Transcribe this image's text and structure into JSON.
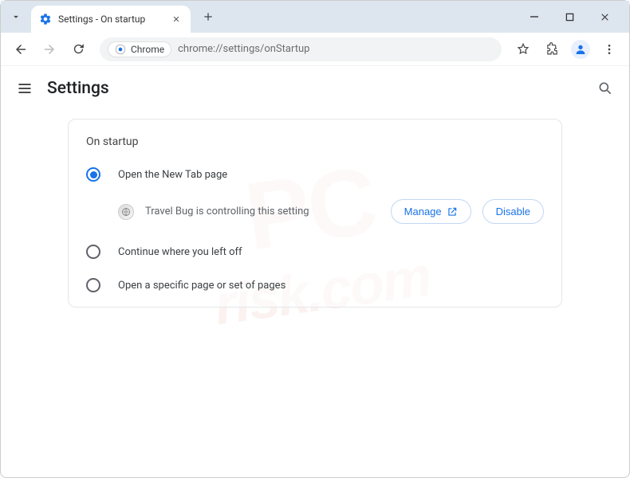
{
  "window": {
    "tab_title": "Settings - On startup",
    "url_chip": "Chrome",
    "url": "chrome://settings/onStartup"
  },
  "settings": {
    "title": "Settings",
    "section_title": "On startup",
    "options": [
      {
        "label": "Open the New Tab page",
        "selected": true
      },
      {
        "label": "Continue where you left off",
        "selected": false
      },
      {
        "label": "Open a specific page or set of pages",
        "selected": false
      }
    ],
    "extension_notice": "Travel Bug is controlling this setting",
    "manage_label": "Manage",
    "disable_label": "Disable"
  },
  "watermark": {
    "line1": "PC",
    "line2": "risk.com"
  }
}
